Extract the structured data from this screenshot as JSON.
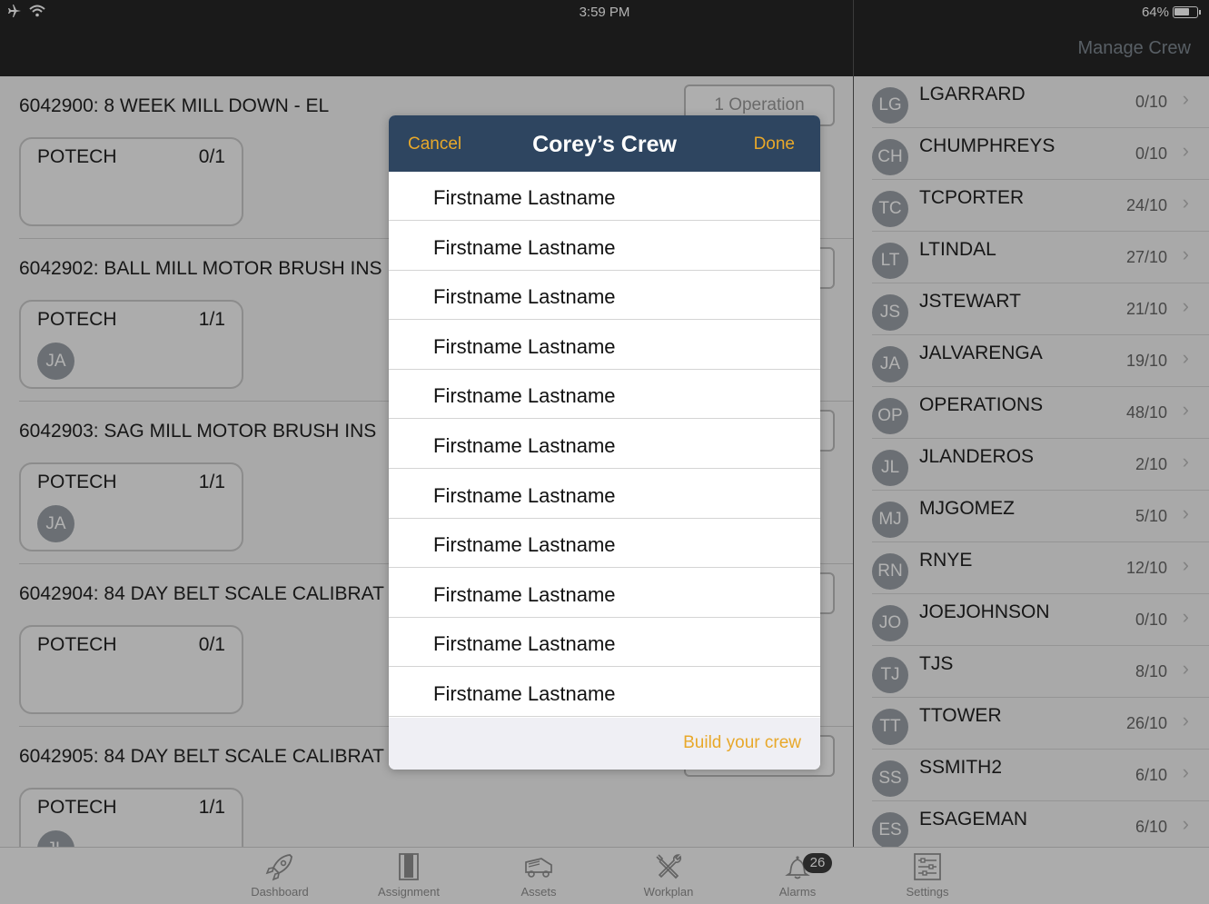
{
  "status_bar": {
    "time": "3:59 PM",
    "battery": "64%",
    "battery_level": 0.64
  },
  "right_header": {
    "title": "Manage Crew"
  },
  "work_orders": [
    {
      "title": "6042900: 8 WEEK MILL DOWN - EL",
      "op_label": "1 Operation",
      "craft": "POTECH",
      "count": "0/1",
      "avatar": ""
    },
    {
      "title": "6042902: BALL MILL MOTOR BRUSH INS",
      "op_label": "",
      "craft": "POTECH",
      "count": "1/1",
      "avatar": "JA"
    },
    {
      "title": "6042903: SAG MILL MOTOR BRUSH INS",
      "op_label": "",
      "craft": "POTECH",
      "count": "1/1",
      "avatar": "JA"
    },
    {
      "title": "6042904: 84 DAY BELT SCALE CALIBRAT",
      "op_label": "",
      "craft": "POTECH",
      "count": "0/1",
      "avatar": ""
    },
    {
      "title": "6042905: 84 DAY BELT SCALE CALIBRAT",
      "op_label": "",
      "craft": "POTECH",
      "count": "1/1",
      "avatar": "JL"
    }
  ],
  "crew": [
    {
      "initials": "LG",
      "name": "LGARRARD",
      "count": "0/10"
    },
    {
      "initials": "CH",
      "name": "CHUMPHREYS",
      "count": "0/10"
    },
    {
      "initials": "TC",
      "name": "TCPORTER",
      "count": "24/10"
    },
    {
      "initials": "LT",
      "name": "LTINDAL",
      "count": "27/10"
    },
    {
      "initials": "JS",
      "name": "JSTEWART",
      "count": "21/10"
    },
    {
      "initials": "JA",
      "name": "JALVARENGA",
      "count": "19/10"
    },
    {
      "initials": "OP",
      "name": "OPERATIONS",
      "count": "48/10"
    },
    {
      "initials": "JL",
      "name": "JLANDEROS",
      "count": "2/10"
    },
    {
      "initials": "MJ",
      "name": "MJGOMEZ",
      "count": "5/10"
    },
    {
      "initials": "RN",
      "name": "RNYE",
      "count": "12/10"
    },
    {
      "initials": "JO",
      "name": "JOEJOHNSON",
      "count": "0/10"
    },
    {
      "initials": "TJ",
      "name": "TJS",
      "count": "8/10"
    },
    {
      "initials": "TT",
      "name": "TTOWER",
      "count": "26/10"
    },
    {
      "initials": "SS",
      "name": "SSMITH2",
      "count": "6/10"
    },
    {
      "initials": "ES",
      "name": "ESAGEMAN",
      "count": "6/10"
    }
  ],
  "modal": {
    "title": "Corey’s Crew",
    "cancel": "Cancel",
    "done": "Done",
    "members": [
      "Firstname Lastname",
      "Firstname Lastname",
      "Firstname Lastname",
      "Firstname Lastname",
      "Firstname Lastname",
      "Firstname Lastname",
      "Firstname Lastname",
      "Firstname Lastname",
      "Firstname Lastname",
      "Firstname Lastname",
      "Firstname Lastname"
    ],
    "build": "Build your crew"
  },
  "tabs": [
    {
      "label": "Dashboard",
      "icon": "rocket-icon"
    },
    {
      "label": "Assignment",
      "icon": "clipboard-icon"
    },
    {
      "label": "Assets",
      "icon": "truck-icon"
    },
    {
      "label": "Workplan",
      "icon": "tools-icon"
    },
    {
      "label": "Alarms",
      "icon": "bell-icon",
      "badge": "26"
    },
    {
      "label": "Settings",
      "icon": "sliders-icon"
    }
  ],
  "colors": {
    "accent": "#e8a82a",
    "header": "#2e4560",
    "topbar": "#262626"
  }
}
